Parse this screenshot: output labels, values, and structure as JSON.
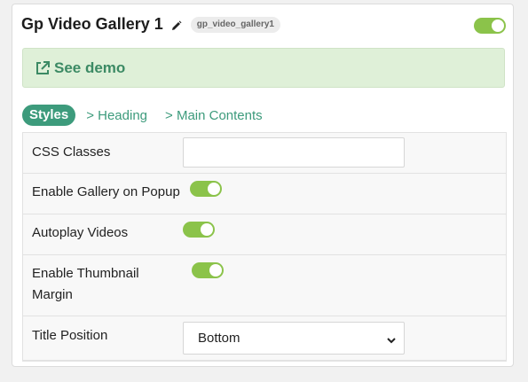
{
  "widget": {
    "title": "Gp Video Gallery 1",
    "slug": "gp_video_gallery1",
    "enabled": true
  },
  "demo": {
    "label": "See demo"
  },
  "tabs": [
    {
      "label": "Styles",
      "active": true
    },
    {
      "label": "> Heading",
      "active": false
    },
    {
      "label": "> Main Contents",
      "active": false
    }
  ],
  "settings": {
    "css_classes": {
      "label": "CSS Classes",
      "value": ""
    },
    "gallery_popup": {
      "label": "Enable Gallery on Popup",
      "on": true
    },
    "autoplay": {
      "label": "Autoplay Videos",
      "on": true
    },
    "thumb_margin": {
      "label_line1": "Enable Thumbnail",
      "label_line2": "Margin",
      "on": true
    },
    "title_position": {
      "label": "Title Position",
      "value": "Bottom"
    }
  },
  "colors": {
    "accent": "#3d9b7c",
    "toggle_on": "#8bc34a",
    "demo_bg": "#dff0d8"
  }
}
